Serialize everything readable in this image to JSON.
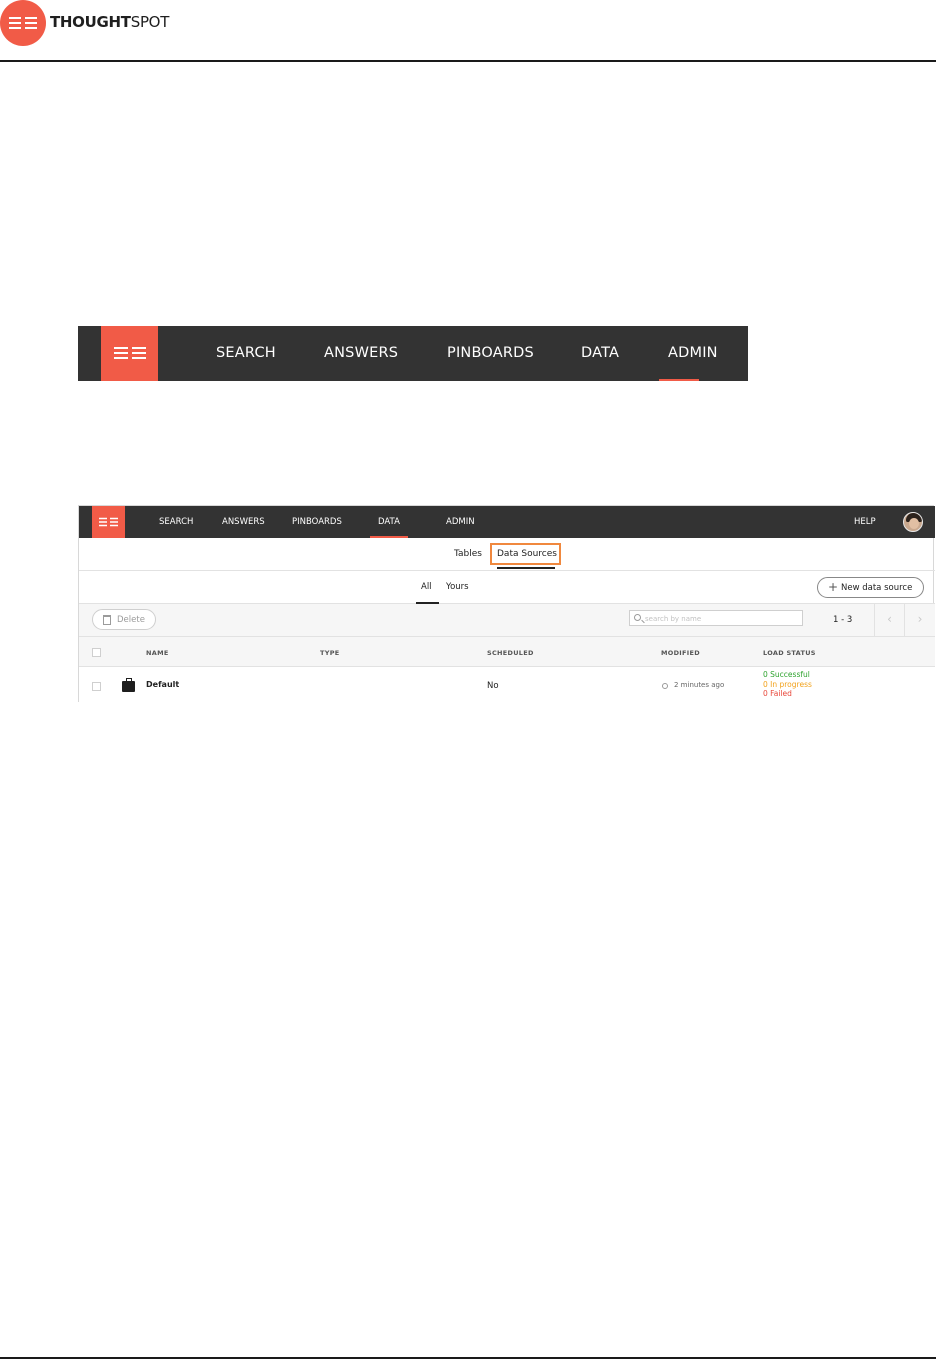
{
  "header": {
    "brand_bold": "THOUGHT",
    "brand_light": "SPOT"
  },
  "big_nav": {
    "items": [
      "SEARCH",
      "ANSWERS",
      "PINBOARDS",
      "DATA",
      "ADMIN"
    ],
    "active": "DATA"
  },
  "screenshot": {
    "nav": {
      "items": [
        "SEARCH",
        "ANSWERS",
        "PINBOARDS",
        "DATA",
        "ADMIN"
      ],
      "help": "HELP"
    },
    "tabs": [
      "Tables",
      "Data Sources"
    ],
    "selected_tab": "Data Sources",
    "subtabs": [
      "All",
      "Yours"
    ],
    "new_button": "New data source",
    "delete_button": "Delete",
    "search_placeholder": "search by name",
    "pager": "1 - 3",
    "columns": [
      "NAME",
      "TYPE",
      "SCHEDULED",
      "MODIFIED",
      "LOAD STATUS"
    ],
    "rows": [
      {
        "name": "Default",
        "type": "",
        "scheduled": "No",
        "modified": "2 minutes ago",
        "status": {
          "successful": "0 Successful",
          "in_progress": "0 In progress",
          "failed": "0 Failed"
        }
      }
    ],
    "colors": {
      "brand": "#f15b47",
      "nav_bg": "#333333",
      "highlight": "#f0883e",
      "success": "#2ea32e",
      "progress": "#f2a21b",
      "failed": "#e8483b"
    }
  }
}
